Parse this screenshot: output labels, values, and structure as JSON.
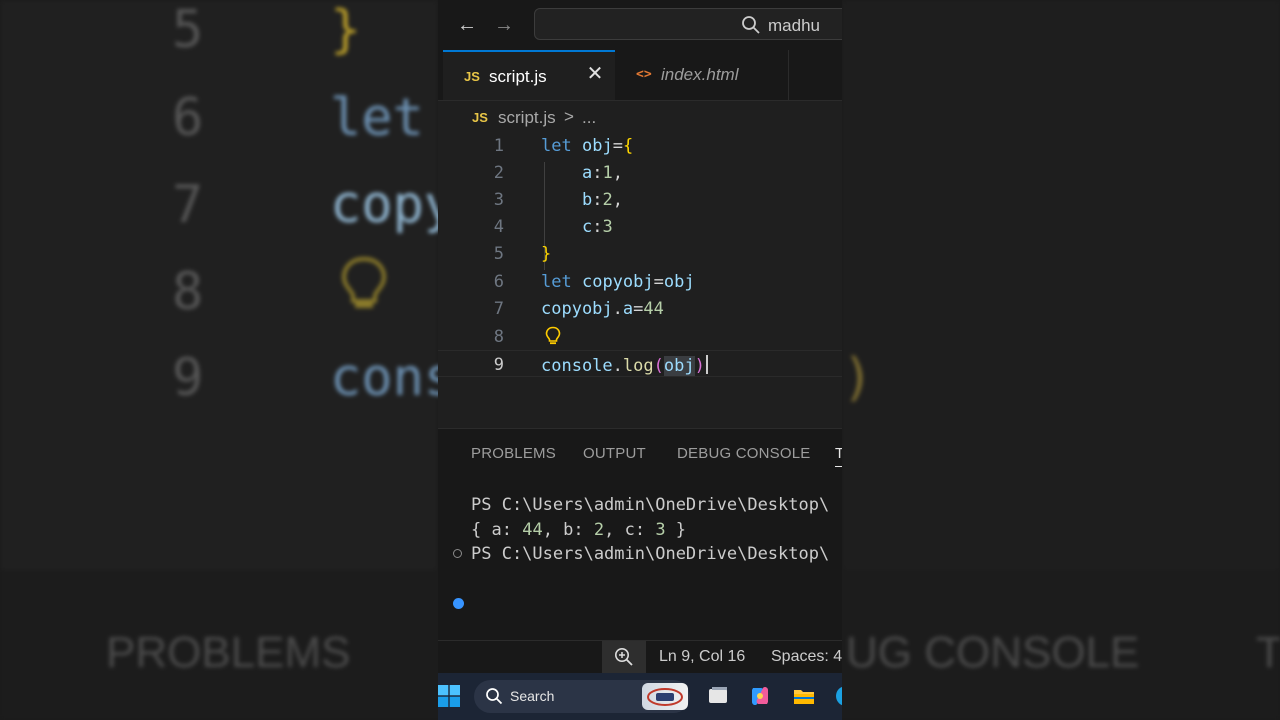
{
  "background": {
    "line_numbers": [
      "5",
      "6",
      "7",
      "8",
      "9"
    ],
    "code_fragments": [
      "}",
      "let",
      "copy",
      "cons",
      ")"
    ],
    "panel_labels": [
      "PROBLEMS",
      "UG CONSOLE",
      "T"
    ]
  },
  "titlebar": {
    "search_text": "madhu"
  },
  "tabs": [
    {
      "icon": "JS",
      "label": "script.js",
      "active": true
    },
    {
      "icon": "<>",
      "label": "index.html",
      "active": false
    }
  ],
  "breadcrumb": {
    "icon": "JS",
    "file": "script.js",
    "separator": ">",
    "more": "..."
  },
  "editor": {
    "line_numbers": [
      "1",
      "2",
      "3",
      "4",
      "5",
      "6",
      "7",
      "8",
      "9"
    ],
    "lines": {
      "l1": {
        "kw": "let",
        "var": "obj",
        "op": "=",
        "brace": "{"
      },
      "l2": {
        "key": "a",
        "op": ":",
        "num": "1",
        "comma": ","
      },
      "l3": {
        "key": "b",
        "op": ":",
        "num": "2",
        "comma": ","
      },
      "l4": {
        "key": "c",
        "op": ":",
        "num": "3"
      },
      "l5": {
        "brace": "}"
      },
      "l6": {
        "kw": "let",
        "var": "copyobj",
        "op": "=",
        "var2": "obj"
      },
      "l7": {
        "var": "copyobj",
        "op": ".",
        "prop": "a",
        "op2": "=",
        "num": "44"
      },
      "l9": {
        "obj": "console",
        "dot": ".",
        "fn": "log",
        "open": "(",
        "arg": "obj",
        "close": ")"
      }
    }
  },
  "panel": {
    "tabs": [
      "PROBLEMS",
      "OUTPUT",
      "DEBUG CONSOLE",
      "T"
    ],
    "terminal": {
      "prompt1": "PS C:\\Users\\admin\\OneDrive\\Desktop\\",
      "output": {
        "open": "{ ",
        "a_key": "a: ",
        "a_val": "44",
        "b_key": ", b: ",
        "b_val": "2",
        "c_key": ", c: ",
        "c_val": "3",
        "close": " }"
      },
      "prompt2": "PS C:\\Users\\admin\\OneDrive\\Desktop\\"
    }
  },
  "statusbar": {
    "position": "Ln 9, Col 16",
    "spaces": "Spaces: 4"
  },
  "taskbar": {
    "search_label": "Search"
  },
  "colors": {
    "accent": "#0078d4",
    "keyword": "#569cd6",
    "variable": "#9cdcfe",
    "number": "#b5cea8",
    "brace": "#ffd700",
    "paren": "#da70d6",
    "function": "#dcdcaa"
  }
}
